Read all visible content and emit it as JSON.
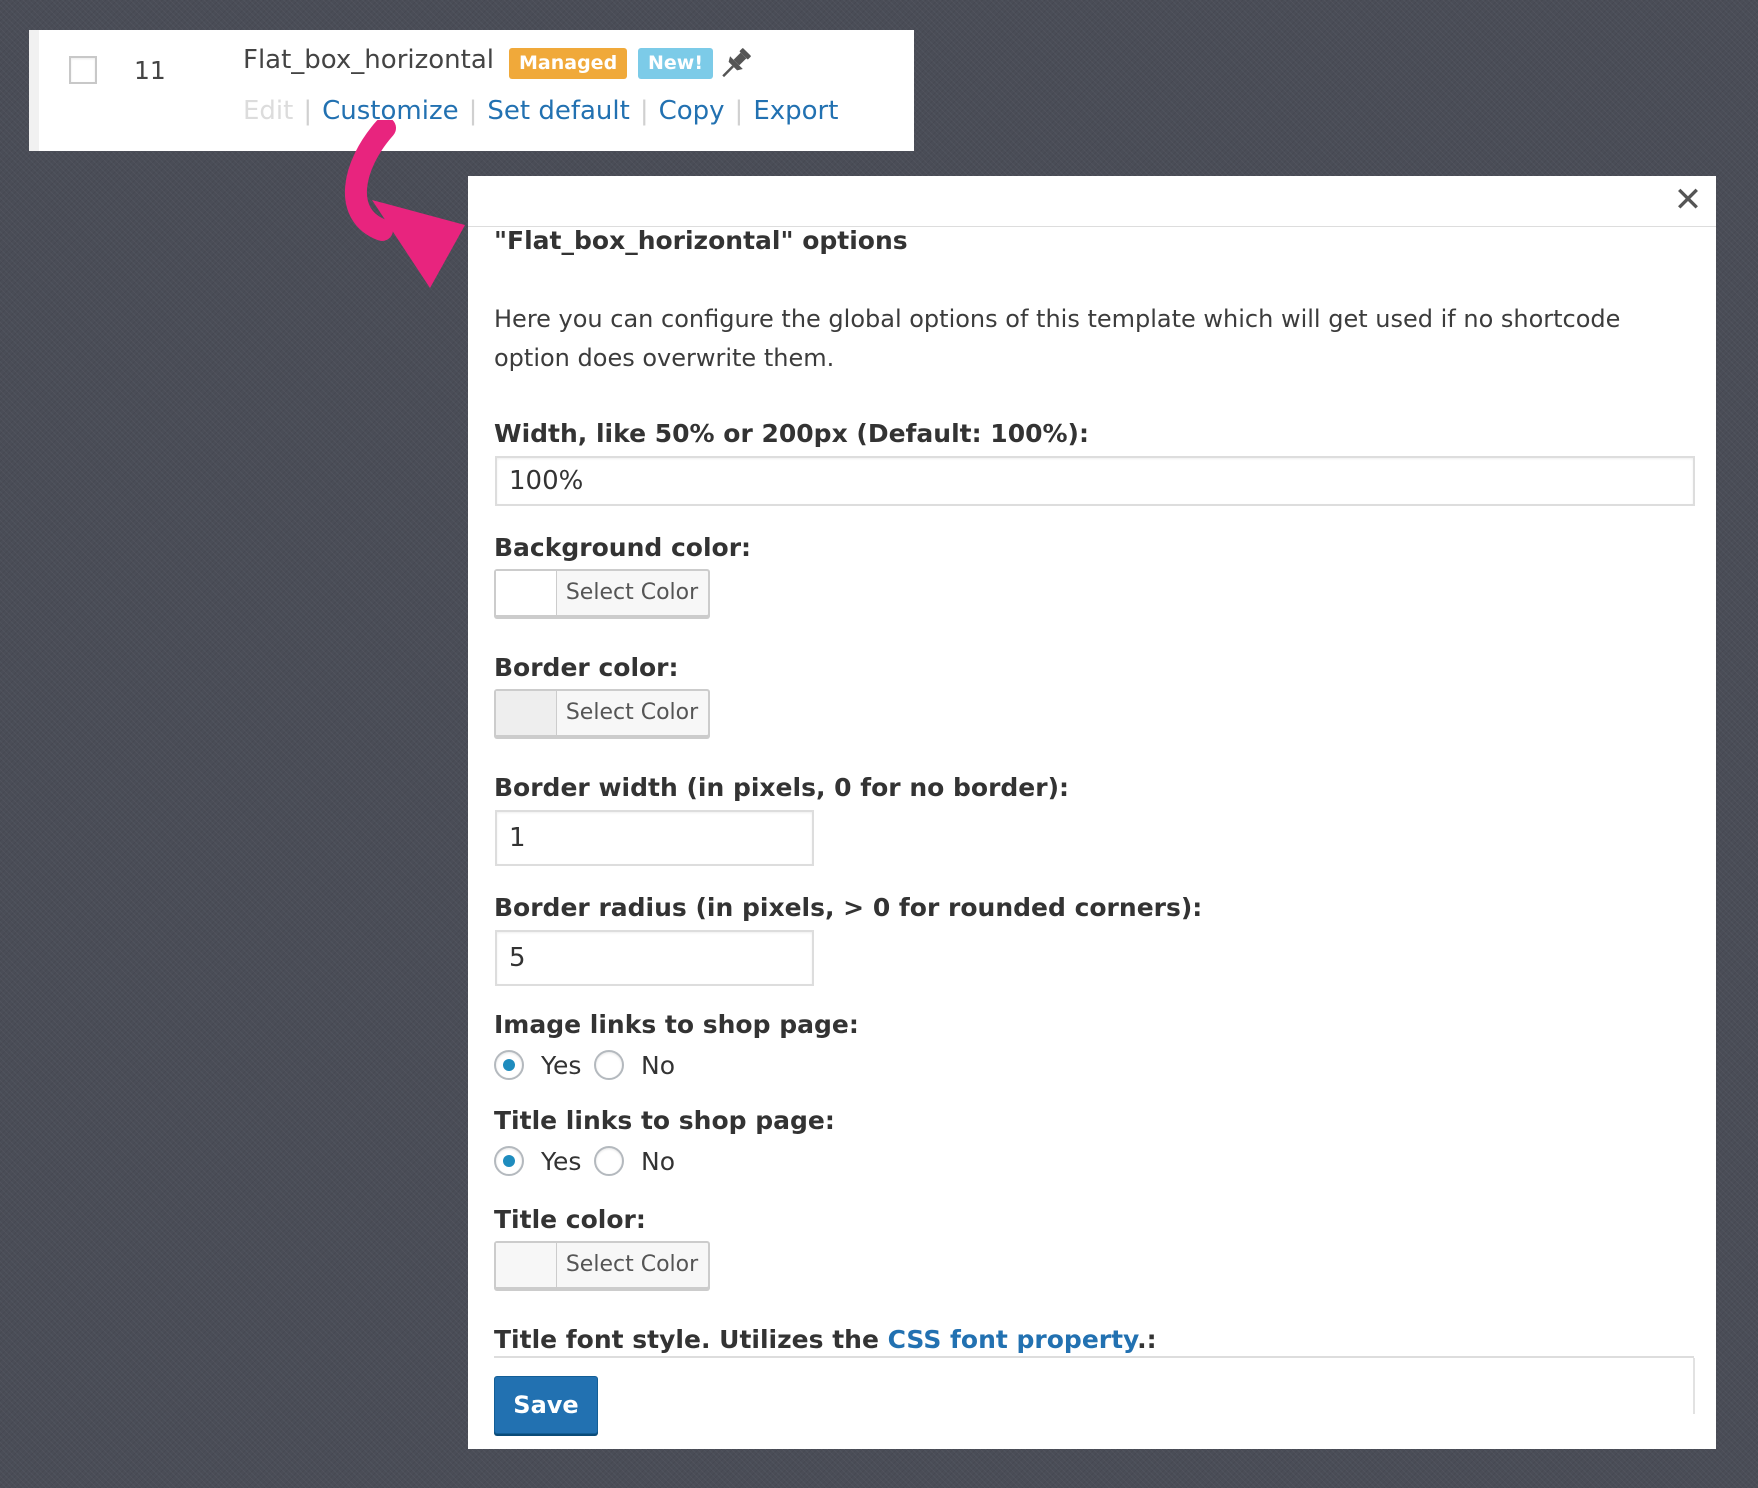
{
  "row": {
    "id": "11",
    "title": "Flat_box_horizontal",
    "badges": {
      "managed": "Managed",
      "new": "New!"
    },
    "actions": {
      "edit": "Edit",
      "customize": "Customize",
      "set_default": "Set default",
      "copy": "Copy",
      "export": "Export"
    },
    "pin_icon": "pushpin-icon"
  },
  "modal": {
    "title": "\"Flat_box_horizontal\" options",
    "description": "Here you can configure the global options of this template which will get used if no shortcode option does overwrite them.",
    "close_symbol": "✕",
    "fields": {
      "width": {
        "label": "Width, like 50% or 200px (Default: 100%):",
        "value": "100%"
      },
      "background_color": {
        "label": "Background color:",
        "button": "Select Color",
        "swatch": "#ffffff"
      },
      "border_color": {
        "label": "Border color:",
        "button": "Select Color",
        "swatch": "#eeeeee"
      },
      "border_width": {
        "label": "Border width (in pixels, 0 for no border):",
        "value": "1"
      },
      "border_radius": {
        "label": "Border radius (in pixels, > 0 for rounded corners):",
        "value": "5"
      },
      "image_links": {
        "label": "Image links to shop page:",
        "yes": "Yes",
        "no": "No",
        "selected": "Yes"
      },
      "title_links": {
        "label": "Title links to shop page:",
        "yes": "Yes",
        "no": "No",
        "selected": "Yes"
      },
      "title_color": {
        "label": "Title color:",
        "button": "Select Color",
        "swatch": "#f7f7f7"
      },
      "title_font": {
        "label_prefix": "Title font style. Utilizes the ",
        "link": "CSS font property",
        "label_suffix": ".:"
      }
    },
    "save_label": "Save"
  },
  "colors": {
    "accent": "#2271b1",
    "managed_badge": "#f0a93a",
    "new_badge": "#7ccbe8",
    "arrow": "#e8247e",
    "background": "#4a4d57"
  }
}
